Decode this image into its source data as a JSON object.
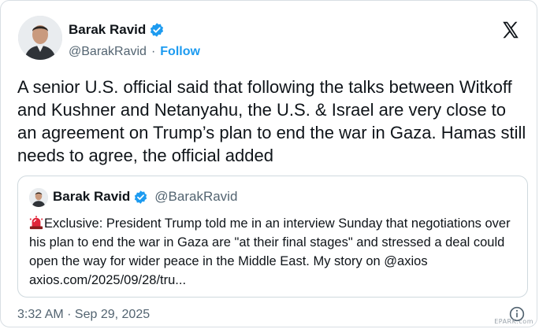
{
  "author": {
    "name": "Barak Ravid",
    "handle": "@BarakRavid",
    "separator": "·",
    "follow_label": "Follow",
    "verified": true
  },
  "tweet": {
    "text": "A senior U.S. official said that following the talks between Witkoff and Kushner and Netanyahu, the U.S. & Israel are very close to an agreement on Trump’s plan to end the war in Gaza. Hamas still needs to agree, the official added",
    "timestamp": "3:32 AM · Sep 29, 2025"
  },
  "quoted_tweet": {
    "name": "Barak Ravid",
    "handle": "@BarakRavid",
    "text": "Exclusive: President Trump told me in an interview Sunday that negotiations over his plan to end the war in Gaza are \"at their final stages\" and stressed a deal could open the way for wider peace in the Middle East. My story on @axios axios.com/2025/09/28/tru..."
  },
  "icons": {
    "verified": "verified-badge-icon",
    "brand": "x-logo-icon",
    "siren": "rotating-light-icon",
    "info": "info-icon"
  },
  "colors": {
    "accent": "#1d9bf0",
    "secondary_text": "#536471",
    "primary_text": "#0f1419",
    "border": "#cfd9de"
  },
  "watermark": "EPARK.com"
}
